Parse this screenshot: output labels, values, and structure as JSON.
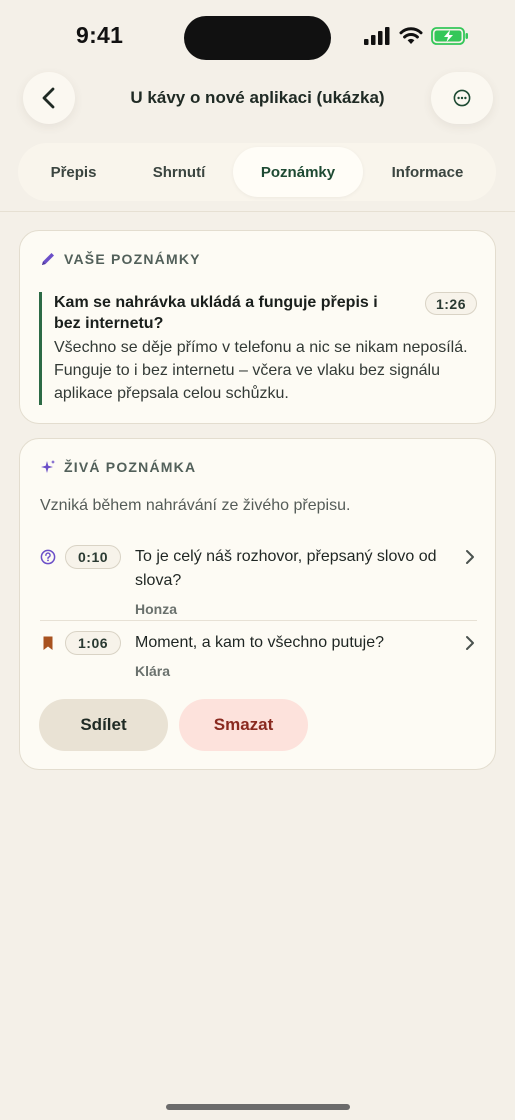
{
  "status": {
    "time": "9:41",
    "icons": [
      "signal-icon",
      "wifi-icon",
      "battery-charging-icon"
    ]
  },
  "header": {
    "title": "U kávy o nové aplikaci (ukázka)",
    "back_icon": "chevron-left-icon",
    "more_icon": "more-horizontal-icon"
  },
  "tabs": [
    {
      "label": "Přepis",
      "active": false
    },
    {
      "label": "Shrnutí",
      "active": false
    },
    {
      "label": "Poznámky",
      "active": true
    },
    {
      "label": "Informace",
      "active": false
    }
  ],
  "notes_card": {
    "heading": "VAŠE POZNÁMKY",
    "icon": "pencil-icon",
    "note": {
      "title": "Kam se nahrávka ukládá a funguje přepis i bez internetu?",
      "time": "1:26",
      "body": "Všechno se děje přímo v telefonu a nic se nikam neposílá. Funguje to i bez internetu – včera ve vlaku bez signálu aplikace přepsala celou schůzku."
    }
  },
  "live_card": {
    "heading": "ŽIVÁ POZNÁMKA",
    "icon": "sparkle-icon",
    "subtitle": "Vzniká během nahrávání ze živého přepisu.",
    "items": [
      {
        "icon": "question-icon",
        "time": "0:10",
        "text": "To je celý náš rozhovor, přepsaný slovo od slova?",
        "speaker": "Honza"
      },
      {
        "icon": "bookmark-icon",
        "time": "1:06",
        "text": "Moment, a kam to všechno putuje?",
        "speaker": "Klára"
      }
    ],
    "share_label": "Sdílet",
    "delete_label": "Smazat"
  },
  "colors": {
    "background": "#f4f0e8",
    "accent_green": "#2c6a45",
    "accent_purple": "#6b4fc8",
    "bookmark": "#a8521f",
    "delete_bg": "#fde2dc",
    "delete_text": "#8a2a20",
    "battery_green": "#34c759"
  }
}
